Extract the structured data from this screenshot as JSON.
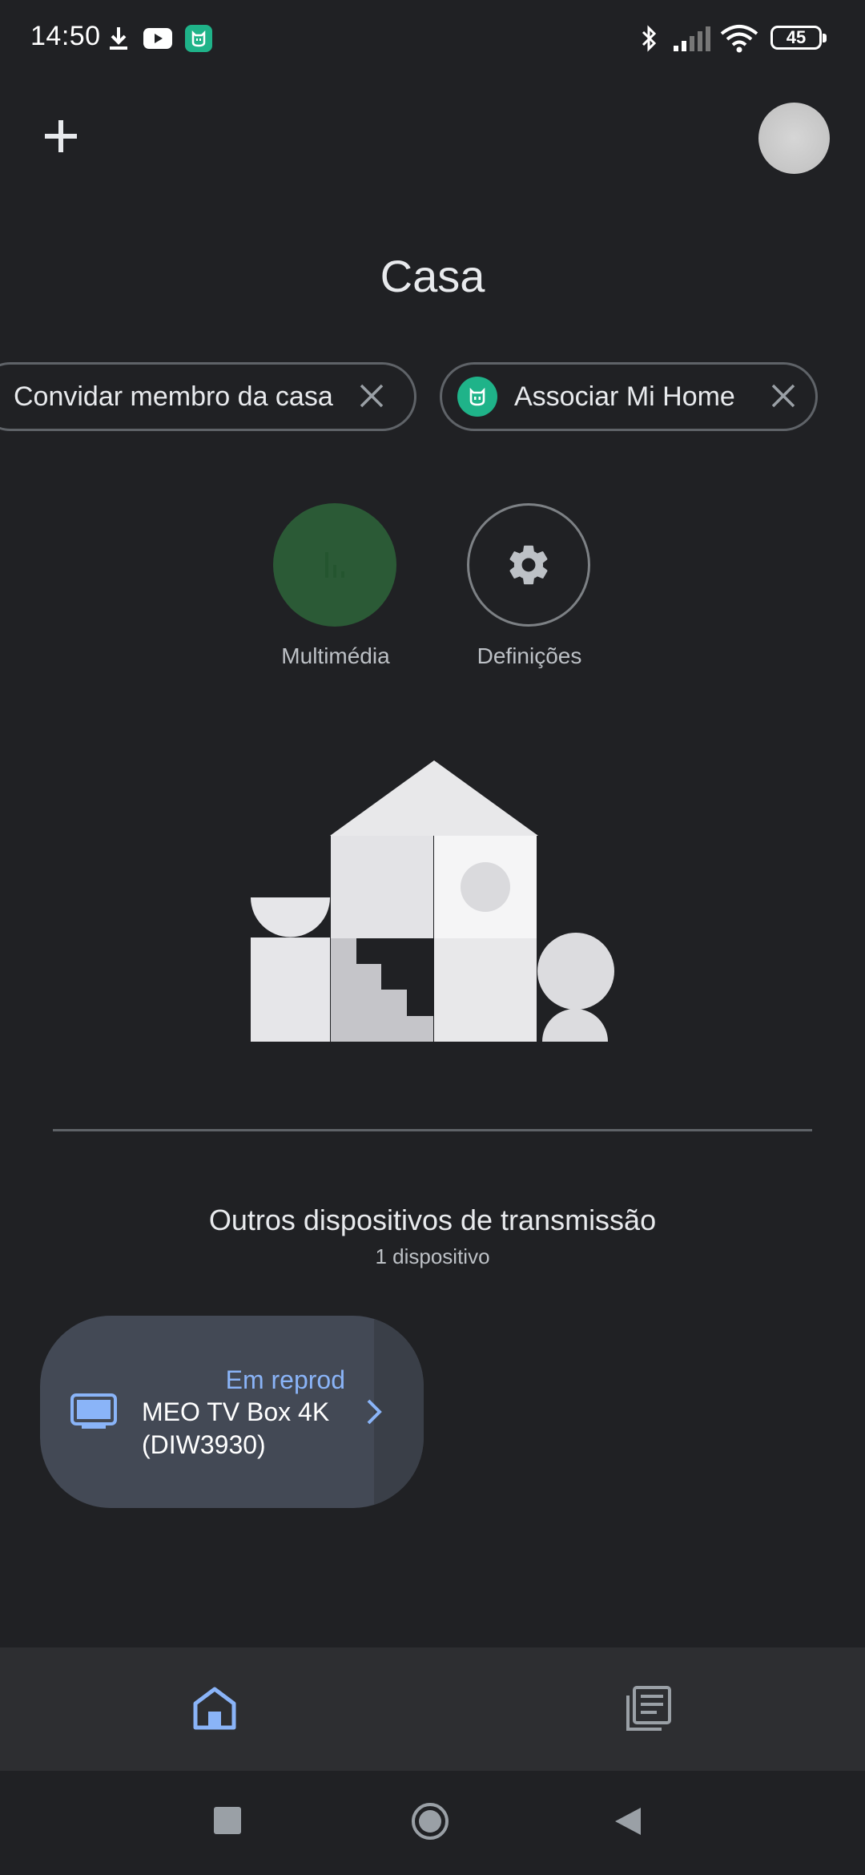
{
  "status_bar": {
    "time": "14:50",
    "battery": "45",
    "icons": [
      "download-icon",
      "youtube-icon",
      "mi-home-icon",
      "bluetooth-icon",
      "signal-icon",
      "wifi-icon",
      "battery-icon"
    ]
  },
  "header": {
    "add_icon": "plus-icon",
    "home_name": "Casa"
  },
  "chips": [
    {
      "label": "Convidar membro da casa",
      "icon": "close-icon"
    },
    {
      "label": "Associar Mi Home",
      "leading_icon": "mi-home-icon",
      "icon": "close-icon"
    }
  ],
  "actions": [
    {
      "label": "Multimédia",
      "icon": "media-icon"
    },
    {
      "label": "Definições",
      "icon": "gear-icon"
    }
  ],
  "section": {
    "title": "Outros dispositivos de transmissão",
    "count": "1 dispositivo"
  },
  "device": {
    "status": "Em reprod",
    "name": "MEO TV Box 4K (DIW3930)",
    "icon": "tv-icon"
  },
  "bottom_nav": [
    {
      "name": "home",
      "icon": "home-icon",
      "active": true
    },
    {
      "name": "feed",
      "icon": "feed-icon",
      "active": false
    }
  ],
  "colors": {
    "background": "#202124",
    "accent": "#8ab4f8",
    "chip_border": "#5f6368",
    "card": "#434955",
    "media_button": "#2b5a36",
    "mi_green": "#1fb389"
  }
}
